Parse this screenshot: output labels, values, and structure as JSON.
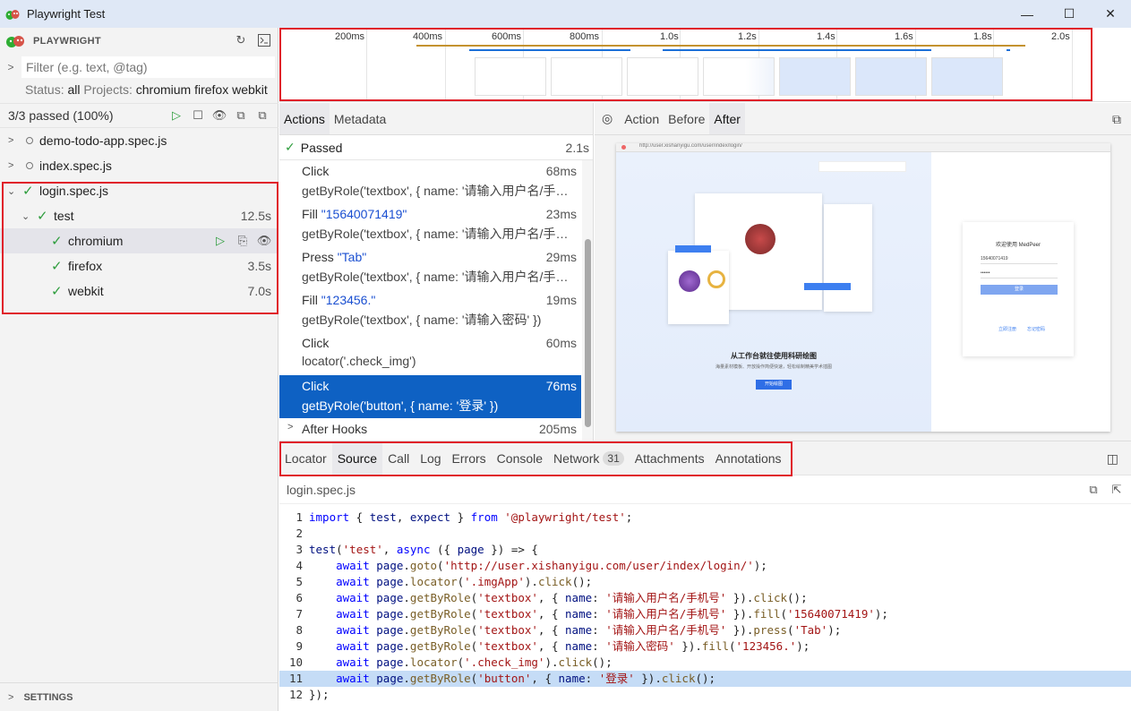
{
  "window": {
    "title": "Playwright Test",
    "minimize": "—",
    "maximize": "☐",
    "close": "✕"
  },
  "sidebar": {
    "brand": "PLAYWRIGHT",
    "filter_placeholder": "Filter (e.g. text, @tag)",
    "status_label": "Status:",
    "status_value": "all",
    "projects_label": "Projects:",
    "projects_value": "chromium firefox webkit",
    "passed_summary": "3/3 passed (100%)",
    "tree": [
      {
        "label": "demo-todo-app.spec.js",
        "duration": ""
      },
      {
        "label": "index.spec.js",
        "duration": ""
      },
      {
        "label": "login.spec.js",
        "duration": ""
      },
      {
        "label": "test",
        "duration": "12.5s"
      },
      {
        "label": "chromium",
        "duration": ""
      },
      {
        "label": "firefox",
        "duration": "3.5s"
      },
      {
        "label": "webkit",
        "duration": "7.0s"
      }
    ],
    "settings": "SETTINGS"
  },
  "timeline": {
    "ticks": [
      "200ms",
      "400ms",
      "600ms",
      "800ms",
      "1.0s",
      "1.2s",
      "1.4s",
      "1.6s",
      "1.8s",
      "2.0s"
    ]
  },
  "actions": {
    "tabs": [
      "Actions",
      "Metadata"
    ],
    "header_label": "Passed",
    "header_duration": "2.1s",
    "items": [
      {
        "title": "Click",
        "title_arg": "",
        "detail": "getByRole('textbox', { name: '请输入用户名/手机号' })",
        "duration": "68ms"
      },
      {
        "title": "Fill ",
        "title_arg": "\"15640071419\"",
        "detail": "getByRole('textbox', { name: '请输入用户名/手机号' })",
        "duration": "23ms"
      },
      {
        "title": "Press ",
        "title_arg": "\"Tab\"",
        "detail": "getByRole('textbox', { name: '请输入用户名/手机号' })",
        "duration": "29ms"
      },
      {
        "title": "Fill ",
        "title_arg": "\"123456.\"",
        "detail": "getByRole('textbox', { name: '请输入密码' })",
        "duration": "19ms"
      },
      {
        "title": "Click",
        "title_arg": "",
        "detail": "locator('.check_img')",
        "duration": "60ms"
      },
      {
        "title": "Click",
        "title_arg": "",
        "detail": "getByRole('button', { name: '登录' })",
        "duration": "76ms"
      }
    ],
    "after_hooks": "After Hooks",
    "after_hooks_duration": "205ms"
  },
  "snapshot": {
    "tabs": [
      "Action",
      "Before",
      "After"
    ],
    "url": "http://user.xishanyigu.com/user/index/login/",
    "hero_title": "从工作台就往使用科研绘图",
    "hero_subtitle": "海量素材模板、开放操作简便快速，轻松绘制精美学术插图",
    "hero_button": "开始绘图",
    "login_title": "欢迎使用 MedPeer",
    "login_user": "15640071419",
    "login_pass": "••••••",
    "login_button": "登录",
    "login_links": [
      "立即注册",
      "忘记密码"
    ]
  },
  "bottom": {
    "tabs": [
      "Locator",
      "Source",
      "Call",
      "Log",
      "Errors",
      "Console",
      "Network",
      "Attachments",
      "Annotations"
    ],
    "network_count": "31",
    "file_name": "login.spec.js"
  },
  "source": {
    "lines": [
      "import { test, expect } from '@playwright/test';",
      "",
      "test('test', async ({ page }) => {",
      "    await page.goto('http://user.xishanyigu.com/user/index/login/');",
      "    await page.locator('.imgApp').click();",
      "    await page.getByRole('textbox', { name: '请输入用户名/手机号' }).click();",
      "    await page.getByRole('textbox', { name: '请输入用户名/手机号' }).fill('15640071419');",
      "    await page.getByRole('textbox', { name: '请输入用户名/手机号' }).press('Tab');",
      "    await page.getByRole('textbox', { name: '请输入密码' }).fill('123456.');",
      "    await page.locator('.check_img').click();",
      "    await page.getByRole('button', { name: '登录' }).click();",
      "});"
    ],
    "highlight_line": 11
  }
}
